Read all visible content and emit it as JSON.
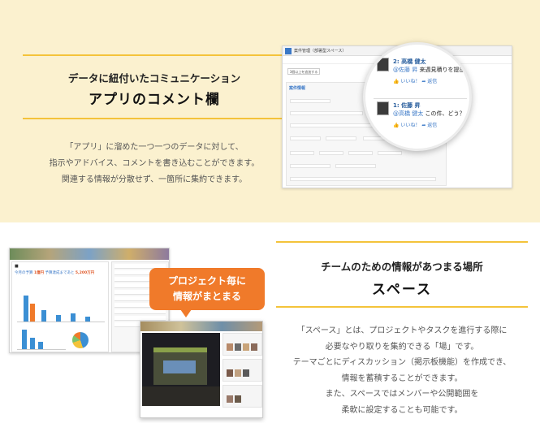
{
  "comment_section": {
    "subtitle": "データに紐付いたコミュニケーション",
    "title": "アプリのコメント欄",
    "description": [
      "「アプリ」に溜めた一つ一つのデータに対して、",
      "指示やアドバイス、コメントを書き込むことができます。",
      "関連する情報が分散せず、一箇所に集約できます。"
    ],
    "screenshot": {
      "window_title": "案件管理（部署型スペース）",
      "add_button": "3個以上を追加する",
      "form_title": "案件情報",
      "comments": [
        {
          "index": "2:",
          "author": "高橋 健太",
          "mention": "@佐藤 昇",
          "text": "来週見積りを提出",
          "like_label": "いいね！",
          "reply_label": "返信"
        },
        {
          "index": "1:",
          "author": "佐藤 昇",
          "mention": "@高橋 健太",
          "text": "この件、どう？",
          "like_label": "いいね！",
          "reply_label": "返信"
        }
      ]
    }
  },
  "space_section": {
    "subtitle": "チームのための情報があつまる場所",
    "title": "スペース",
    "description": [
      "「スペース」とは、プロジェクトやタスクを進行する際に",
      "必要なやり取りを集約できる「場」です。",
      "テーマごとにディスカッション（掲示板機能）を作成でき、",
      "情報を蓄積することができます。",
      "また、スペースではメンバーや公開範囲を",
      "柔軟に設定することも可能です。"
    ],
    "callout": [
      "プロジェクト毎に",
      "情報がまとまる"
    ],
    "screenshot": {
      "target_text": "今月の予算",
      "target_value": "1億円",
      "target_detail": "予算達成まであと",
      "target_remaining": "5,200万円"
    }
  },
  "colors": {
    "panel_background": "#fbf1cf",
    "accent": "#f4c33a",
    "callout": "#f07a2a",
    "link_blue": "#3a78c7"
  }
}
